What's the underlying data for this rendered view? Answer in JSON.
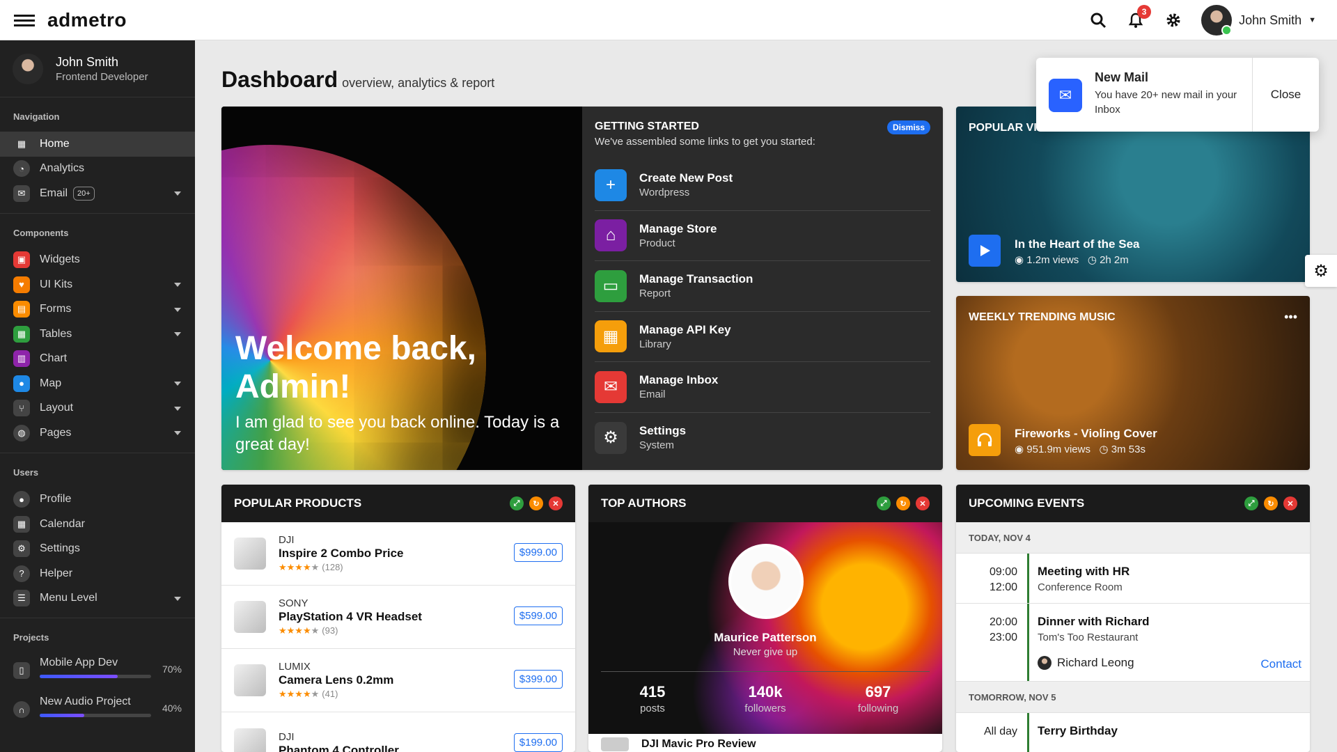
{
  "app": {
    "brand": "admetro"
  },
  "topbar": {
    "notification_count": "3",
    "user_name": "John Smith"
  },
  "sidebar": {
    "user": {
      "name": "John Smith",
      "role": "Frontend Developer"
    },
    "navigation": {
      "heading": "Navigation",
      "items": [
        {
          "label": "Home",
          "active": true
        },
        {
          "label": "Analytics"
        },
        {
          "label": "Email",
          "pill": "20+"
        }
      ]
    },
    "components": {
      "heading": "Components",
      "items": [
        {
          "label": "Widgets"
        },
        {
          "label": "UI Kits"
        },
        {
          "label": "Forms"
        },
        {
          "label": "Tables"
        },
        {
          "label": "Chart"
        },
        {
          "label": "Map"
        },
        {
          "label": "Layout"
        },
        {
          "label": "Pages"
        }
      ]
    },
    "users": {
      "heading": "Users",
      "items": [
        {
          "label": "Profile"
        },
        {
          "label": "Calendar"
        },
        {
          "label": "Settings"
        },
        {
          "label": "Helper"
        },
        {
          "label": "Menu Level"
        }
      ]
    },
    "projects": {
      "heading": "Projects",
      "items": [
        {
          "label": "Mobile App Dev",
          "percent": "70%",
          "progress": 0.7
        },
        {
          "label": "New Audio Project",
          "percent": "40%",
          "progress": 0.4
        }
      ]
    }
  },
  "page": {
    "title": "Dashboard",
    "subtitle": "overview, analytics & report"
  },
  "welcome": {
    "title": "Welcome back, Admin!",
    "subtitle": "I am glad to see you back online. Today is a great day!"
  },
  "getting_started": {
    "title": "GETTING STARTED",
    "subtitle": "We've assembled some links to get you started:",
    "dismiss": "Dismiss",
    "items": [
      {
        "name": "Create New Post",
        "desc": "Wordpress",
        "color": "#1e88e5"
      },
      {
        "name": "Manage Store",
        "desc": "Product",
        "color": "#7b1fa2"
      },
      {
        "name": "Manage Transaction",
        "desc": "Report",
        "color": "#2e9e3e"
      },
      {
        "name": "Manage API Key",
        "desc": "Library",
        "color": "#f59e0b"
      },
      {
        "name": "Manage Inbox",
        "desc": "Email",
        "color": "#e53935"
      },
      {
        "name": "Settings",
        "desc": "System",
        "color": "#3a3a3a"
      }
    ]
  },
  "notification": {
    "title": "New Mail",
    "text": "You have 20+ new mail in your Inbox",
    "close": "Close"
  },
  "videos": {
    "title": "POPULAR VIDEOS",
    "item": {
      "name": "In the Heart of the Sea",
      "views": "1.2m views",
      "duration": "2h 2m"
    }
  },
  "music": {
    "title": "WEEKLY TRENDING MUSIC",
    "item": {
      "name": "Fireworks - Violing Cover",
      "views": "951.9m views",
      "duration": "3m 53s"
    }
  },
  "products": {
    "title": "POPULAR PRODUCTS",
    "items": [
      {
        "brand": "DJI",
        "name": "Inspire 2 Combo Price",
        "reviews": "(128)",
        "price": "$999.00"
      },
      {
        "brand": "SONY",
        "name": "PlayStation 4 VR Headset",
        "reviews": "(93)",
        "price": "$599.00"
      },
      {
        "brand": "LUMIX",
        "name": "Camera Lens 0.2mm",
        "reviews": "(41)",
        "price": "$399.00"
      },
      {
        "brand": "DJI",
        "name": "Phantom 4 Controller",
        "reviews": "",
        "price": "$199.00"
      }
    ]
  },
  "authors": {
    "title": "TOP AUTHORS",
    "name": "Maurice Patterson",
    "tagline": "Never give up",
    "stats": [
      {
        "value": "415",
        "label": "posts"
      },
      {
        "value": "140k",
        "label": "followers"
      },
      {
        "value": "697",
        "label": "following"
      }
    ],
    "next_item": "DJI Mavic Pro Review"
  },
  "events": {
    "title": "UPCOMING EVENTS",
    "today": "TODAY, NOV 4",
    "items": [
      {
        "start": "09:00",
        "end": "12:00",
        "title": "Meeting with HR",
        "location": "Conference Room"
      },
      {
        "start": "20:00",
        "end": "23:00",
        "title": "Dinner with Richard",
        "location": "Tom's Too Restaurant",
        "person": "Richard Leong",
        "action": "Contact"
      }
    ],
    "tomorrow": "TOMORROW, NOV 5",
    "tomorrow_item": {
      "time": "All day",
      "title": "Terry Birthday"
    }
  },
  "colors": {
    "accent": "#1e6ef0",
    "sidebar_bg": "#212121",
    "panel_head": "#1b1b1b"
  }
}
